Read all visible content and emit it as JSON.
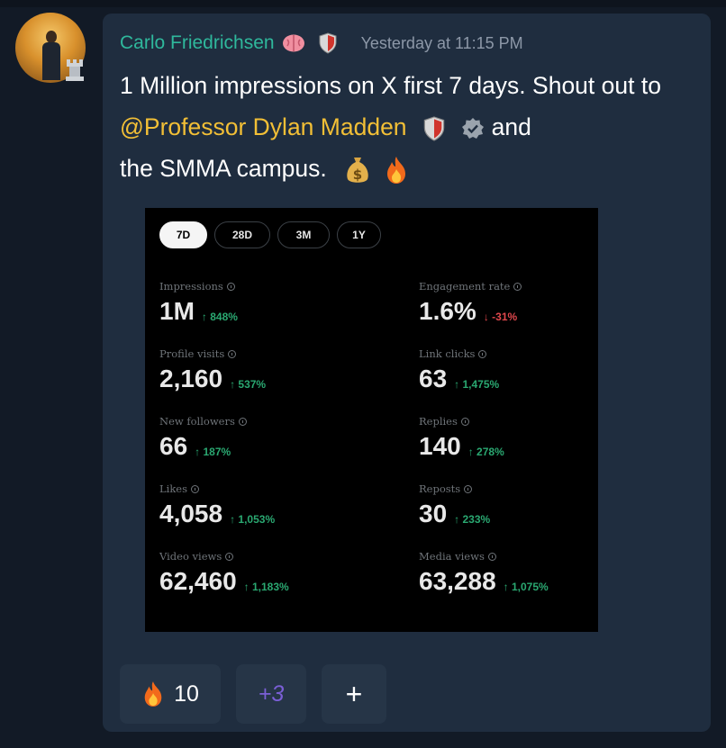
{
  "message": {
    "username": "Carlo Friedrichsen",
    "timestamp": "Yesterday at 11:15 PM",
    "text_part1": "1 Million impressions on X first 7 days. Shout out to ",
    "mention": "@Professor Dylan Madden",
    "text_part2": " and",
    "text_part3": "the SMMA campus."
  },
  "colors": {
    "username": "#2fb89c",
    "mention": "#f2bf36",
    "card_bg": "#1f2d3f",
    "positive": "#2aa871",
    "negative": "#e0474c"
  },
  "stats_panel": {
    "tabs": [
      "7D",
      "28D",
      "3M",
      "1Y"
    ],
    "active_tab": "7D",
    "metrics": [
      {
        "label": "Impressions",
        "value": "1M",
        "change": "↑ 848%"
      },
      {
        "label": "Engagement rate",
        "value": "1.6%",
        "change": "↓ -31%"
      },
      {
        "label": "Profile visits",
        "value": "2,160",
        "change": "↑ 537%"
      },
      {
        "label": "Link clicks",
        "value": "63",
        "change": "↑ 1,475%"
      },
      {
        "label": "New followers",
        "value": "66",
        "change": "↑ 187%"
      },
      {
        "label": "Replies",
        "value": "140",
        "change": "↑ 278%"
      },
      {
        "label": "Likes",
        "value": "4,058",
        "change": "↑ 1,053%"
      },
      {
        "label": "Reposts",
        "value": "30",
        "change": "↑ 233%"
      },
      {
        "label": "Video views",
        "value": "62,460",
        "change": "↑ 1,183%"
      },
      {
        "label": "Media views",
        "value": "63,288",
        "change": "↑ 1,075%"
      }
    ]
  },
  "reactions": {
    "fire_count": "10",
    "more_count": "+3",
    "add_label": "+"
  }
}
